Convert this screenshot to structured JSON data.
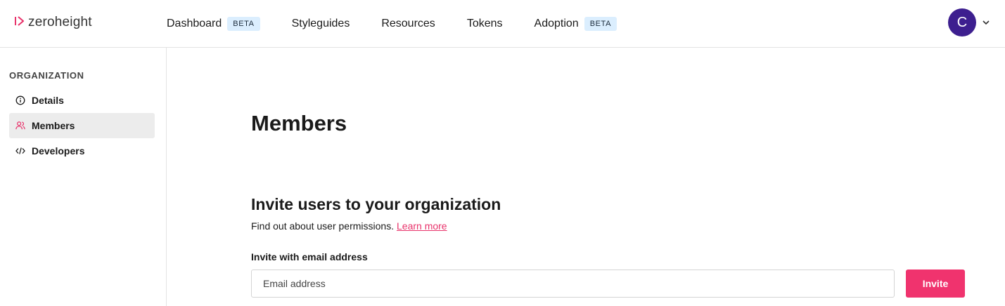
{
  "brand": {
    "name": "zeroheight",
    "accent": "#e8336b"
  },
  "nav": {
    "items": [
      {
        "label": "Dashboard",
        "badge": "BETA"
      },
      {
        "label": "Styleguides"
      },
      {
        "label": "Resources"
      },
      {
        "label": "Tokens"
      },
      {
        "label": "Adoption",
        "badge": "BETA"
      }
    ]
  },
  "user": {
    "avatar_initial": "C",
    "avatar_color": "#3d1f8f"
  },
  "sidebar": {
    "heading": "ORGANIZATION",
    "items": [
      {
        "label": "Details",
        "icon": "info-icon"
      },
      {
        "label": "Members",
        "icon": "users-icon",
        "active": true
      },
      {
        "label": "Developers",
        "icon": "code-icon"
      }
    ]
  },
  "main": {
    "title": "Members",
    "invite": {
      "title": "Invite users to your organization",
      "description": "Find out about user permissions.",
      "learn_more": "Learn more",
      "field_label": "Invite with email address",
      "email_placeholder": "Email address",
      "button_label": "Invite",
      "button_color": "#f0336e"
    }
  }
}
